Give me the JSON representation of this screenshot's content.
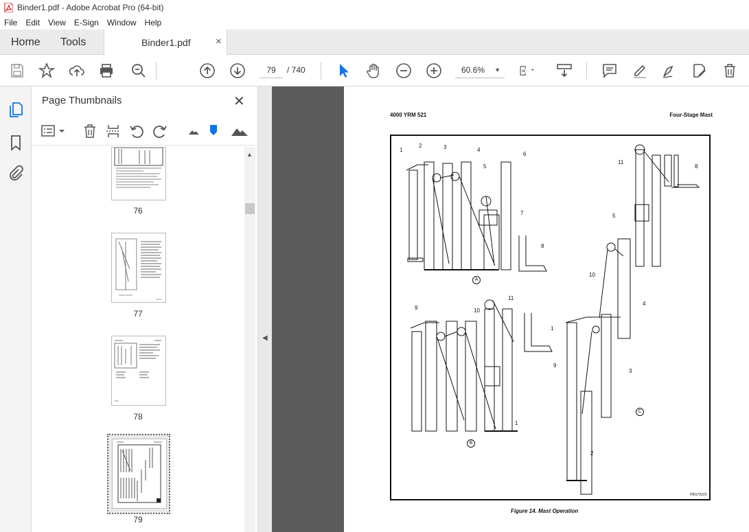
{
  "window": {
    "title": "Binder1.pdf - Adobe Acrobat Pro (64-bit)"
  },
  "menu": [
    "File",
    "Edit",
    "View",
    "E-Sign",
    "Window",
    "Help"
  ],
  "tabs": {
    "home": "Home",
    "tools": "Tools",
    "document": "Binder1.pdf",
    "close": "×"
  },
  "toolbar": {
    "page_current": "79",
    "page_total": "/ 740",
    "zoom": "60.6%",
    "icons": [
      "save-icon",
      "bookmark-star-icon",
      "upload-icon",
      "print-icon",
      "search-zoom-icon",
      "prev-page-icon",
      "next-page-icon",
      "select-cursor-icon",
      "hand-icon",
      "zoom-out-icon",
      "zoom-in-icon",
      "fit-page-icon",
      "scroll-mode-icon",
      "comment-icon",
      "highlight-icon",
      "sign-icon",
      "edit-pdf-icon",
      "delete-icon"
    ]
  },
  "sidebar": {
    "title": "Page Thumbnails",
    "close": "✕",
    "thumbnails": [
      {
        "label": "76"
      },
      {
        "label": "77"
      },
      {
        "label": "78"
      },
      {
        "label": "79",
        "selected": true
      }
    ]
  },
  "document": {
    "header_left": "4000 YRM 521",
    "header_right": "Four-Stage Mast",
    "caption": "Figure 14.  Mast Operation",
    "figure_code": "HM170223",
    "callouts": [
      "1",
      "2",
      "3",
      "4",
      "5",
      "6",
      "7",
      "8",
      "9",
      "10",
      "11"
    ],
    "section_labels": [
      "A",
      "B",
      "C"
    ]
  }
}
